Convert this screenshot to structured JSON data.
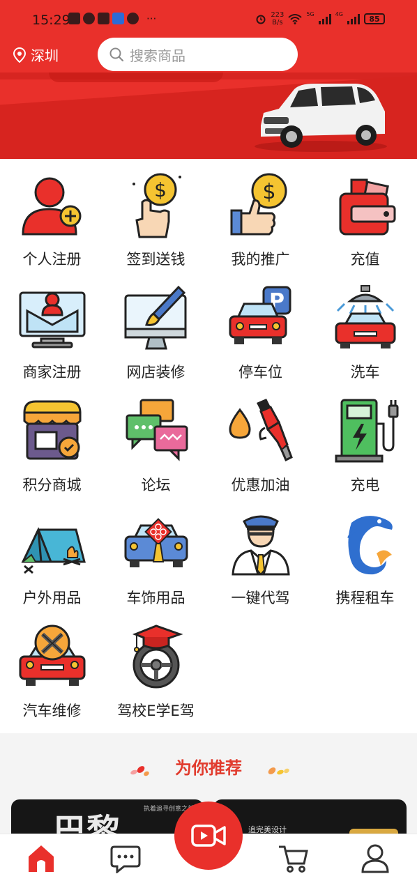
{
  "status_bar": {
    "time": "15:29",
    "dots": "···",
    "speed_value": "223",
    "speed_unit": "B/s",
    "net1": "5G",
    "net2": "4G",
    "battery": "85"
  },
  "header": {
    "location": "深圳",
    "search_placeholder": "搜索商品"
  },
  "colors": {
    "brand_red": "#e9302b",
    "title_red": "#e13b2d"
  },
  "grid": [
    {
      "label": "个人注册",
      "icon": "user-add-icon"
    },
    {
      "label": "签到送钱",
      "icon": "coin-tap-icon"
    },
    {
      "label": "我的推广",
      "icon": "thumbs-up-coin-icon"
    },
    {
      "label": "充值",
      "icon": "wallet-icon"
    },
    {
      "label": "商家注册",
      "icon": "merchant-monitor-icon"
    },
    {
      "label": "网店装修",
      "icon": "paint-monitor-icon"
    },
    {
      "label": "停车位",
      "icon": "parking-car-icon"
    },
    {
      "label": "洗车",
      "icon": "car-wash-icon"
    },
    {
      "label": "积分商城",
      "icon": "shop-badge-icon"
    },
    {
      "label": "论坛",
      "icon": "chat-bubbles-icon"
    },
    {
      "label": "优惠加油",
      "icon": "fuel-nozzle-icon"
    },
    {
      "label": "充电",
      "icon": "charging-station-icon"
    },
    {
      "label": "户外用品",
      "icon": "camping-tent-icon"
    },
    {
      "label": "车饰用品",
      "icon": "car-knot-icon"
    },
    {
      "label": "一键代驾",
      "icon": "chauffeur-icon"
    },
    {
      "label": "携程租车",
      "icon": "dolphin-icon"
    },
    {
      "label": "汽车维修",
      "icon": "car-repair-icon"
    },
    {
      "label": "驾校E学E驾",
      "icon": "driving-school-icon"
    }
  ],
  "recommend": {
    "title": "为你推荐",
    "card1_small": "执着追寻创意之美",
    "card1_big": "巴黎",
    "card2_text": "追完美设计"
  },
  "tabbar": {
    "items": [
      "home-icon",
      "message-icon",
      "video-icon",
      "cart-icon",
      "profile-icon"
    ]
  }
}
